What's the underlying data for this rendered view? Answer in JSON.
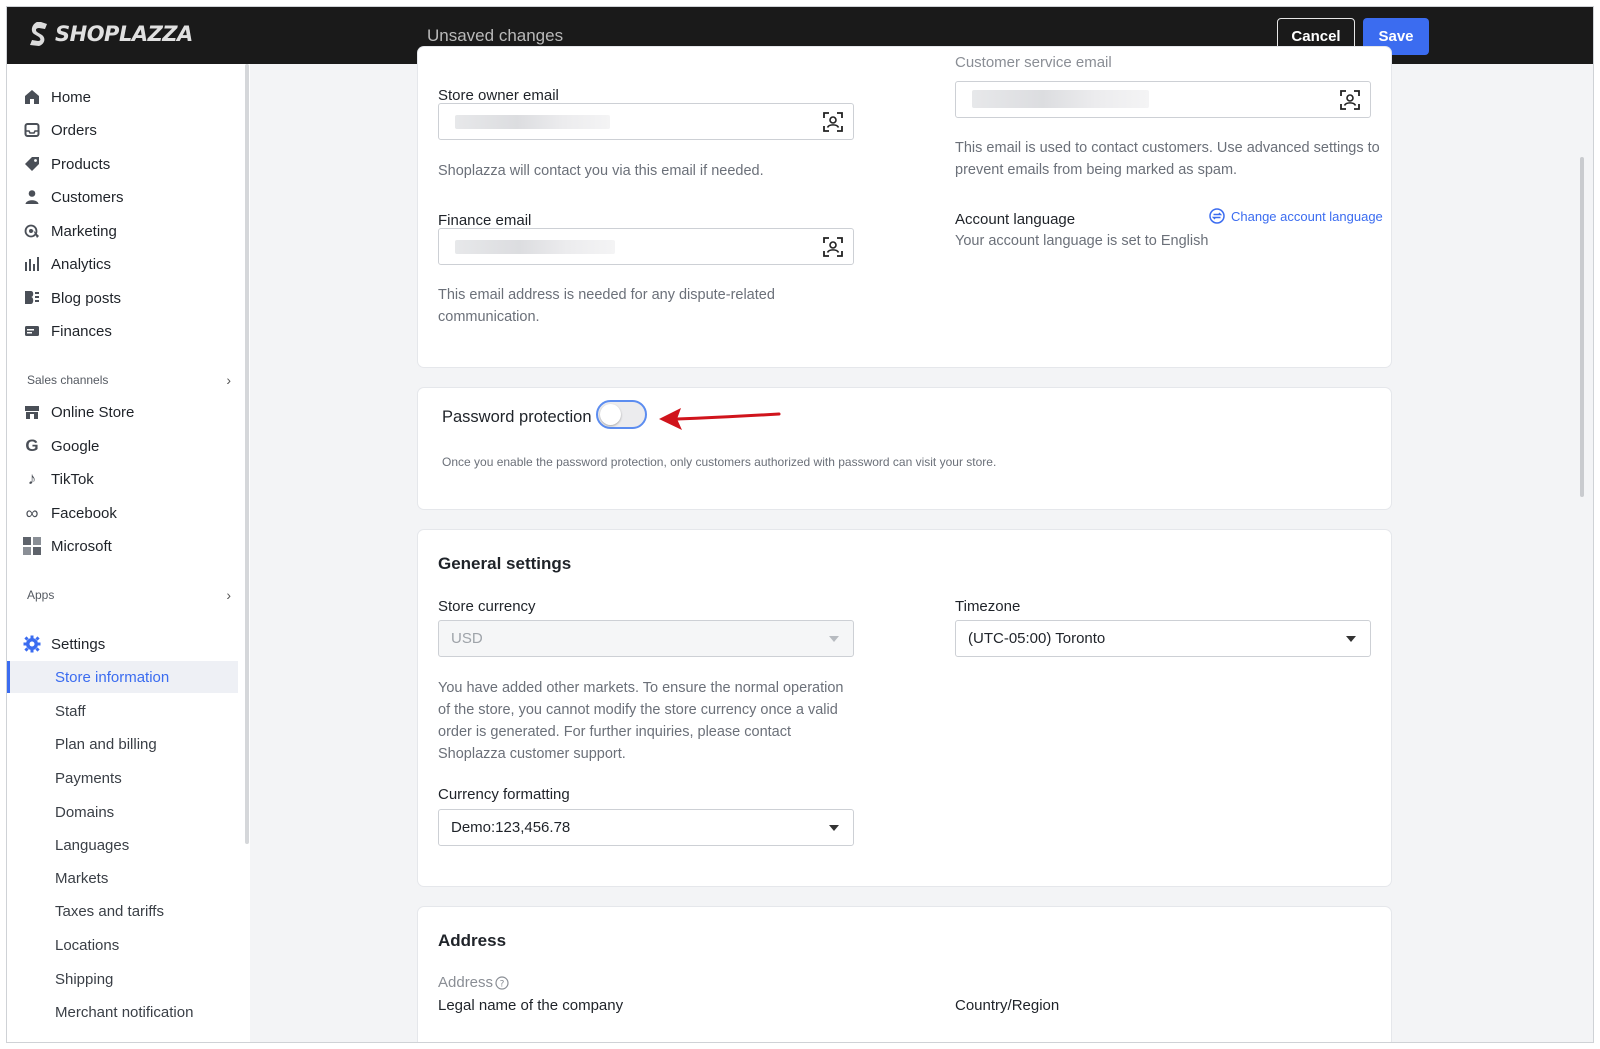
{
  "topbar": {
    "brand": "SHOPLAZZA",
    "status": "Unsaved changes",
    "cancel_label": "Cancel",
    "save_label": "Save"
  },
  "sidebar": {
    "main_items": [
      {
        "label": "Home",
        "icon": "home-icon"
      },
      {
        "label": "Orders",
        "icon": "inbox-icon"
      },
      {
        "label": "Products",
        "icon": "tag-icon"
      },
      {
        "label": "Customers",
        "icon": "person-icon"
      },
      {
        "label": "Marketing",
        "icon": "target-icon"
      },
      {
        "label": "Analytics",
        "icon": "bar-chart-icon"
      },
      {
        "label": "Blog posts",
        "icon": "blog-icon"
      },
      {
        "label": "Finances",
        "icon": "wallet-icon"
      }
    ],
    "sales_channels_label": "Sales channels",
    "channels": [
      {
        "label": "Online Store",
        "icon": "store-icon"
      },
      {
        "label": "Google",
        "icon": "google-icon"
      },
      {
        "label": "TikTok",
        "icon": "tiktok-icon"
      },
      {
        "label": "Facebook",
        "icon": "meta-icon"
      },
      {
        "label": "Microsoft",
        "icon": "microsoft-icon"
      }
    ],
    "apps_label": "Apps",
    "settings_label": "Settings",
    "settings_items": [
      "Store information",
      "Staff",
      "Plan and billing",
      "Payments",
      "Domains",
      "Languages",
      "Markets",
      "Taxes and tariffs",
      "Locations",
      "Shipping",
      "Merchant notification"
    ],
    "active_settings_item": "Store information"
  },
  "contact_card": {
    "customer_service_label": "Customer service email",
    "store_owner_email_label": "Store owner email",
    "store_owner_help": "Shoplazza will contact you via this email if needed.",
    "finance_email_label": "Finance email",
    "finance_help": "This email address is needed for any dispute-related communication.",
    "customer_service_help": "This email is used to contact customers. Use advanced settings to prevent emails from being marked as spam.",
    "account_language_label": "Account language",
    "change_language_link": "Change account language",
    "account_language_help": "Your account language is set to English"
  },
  "password_card": {
    "title": "Password protection",
    "enabled": false,
    "help": "Once you enable the password protection, only customers authorized with password can visit your store."
  },
  "general_card": {
    "title": "General settings",
    "currency_label": "Store currency",
    "currency_value": "USD",
    "currency_help": "You have added other markets. To ensure the normal operation of the store, you cannot modify the store currency once a valid order is generated. For further inquiries, please contact Shoplazza customer support.",
    "timezone_label": "Timezone",
    "timezone_value": "(UTC-05:00) Toronto",
    "formatting_label": "Currency formatting",
    "formatting_value": "Demo:123,456.78"
  },
  "address_card": {
    "title": "Address",
    "address_label": "Address",
    "legal_name_label": "Legal name of the company",
    "country_label": "Country/Region"
  },
  "colors": {
    "accent": "#3b6cf0",
    "topbar": "#1a1a1a",
    "annotation_arrow": "#d0141c"
  }
}
